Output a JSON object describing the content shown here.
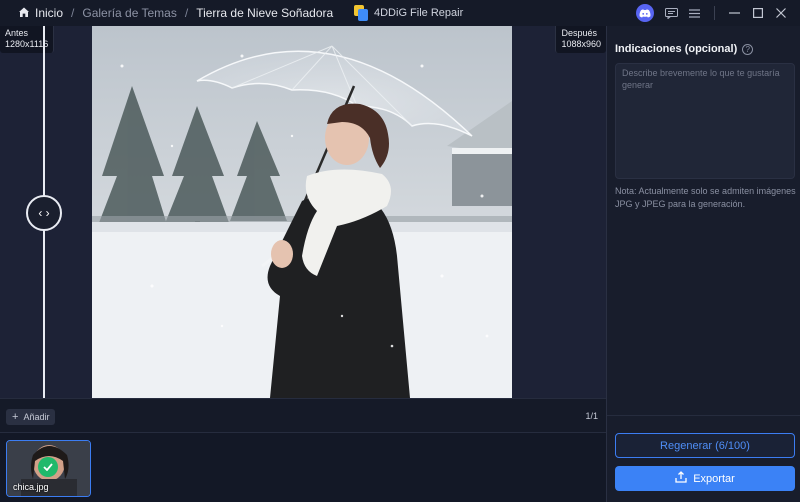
{
  "breadcrumb": {
    "home_label": "Inicio",
    "separator": "/",
    "gallery_label": "Galería de Temas",
    "current_label": "Tierra de Nieve Soñadora"
  },
  "app": {
    "title": "4DDiG File Repair"
  },
  "compare": {
    "before_label": "Antes",
    "before_size": "1280x1116",
    "after_label": "Después",
    "after_size": "1088x960",
    "slider_glyph": "‹ ›"
  },
  "toolbar": {
    "add_label": "Añadir",
    "page_count": "1/1"
  },
  "thumbnails": [
    {
      "file_name": "chica.jpg",
      "selected": true
    }
  ],
  "panel": {
    "title": "Indicaciones (opcional)",
    "help_glyph": "?",
    "prompt_placeholder": "Describe brevemente lo que te gustaría generar",
    "prompt_value": "",
    "note": "Nota: Actualmente solo se admiten imágenes JPG y JPEG para la generación.",
    "regenerate_label": "Regenerar (6/100)",
    "export_label": "Exportar"
  },
  "icons": [
    "home-icon",
    "discord-icon",
    "feedback-icon",
    "menu-icon",
    "minimize-icon",
    "maximize-icon",
    "close-icon",
    "help-icon",
    "check-icon",
    "export-icon",
    "plus-icon"
  ],
  "colors": {
    "accent": "#3b82f6",
    "success": "#20b96b",
    "discord": "#5865f2",
    "background": "#131826"
  }
}
